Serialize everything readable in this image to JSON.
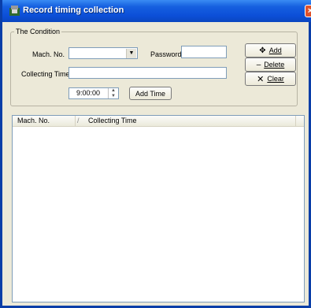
{
  "window": {
    "title": "Record timing collection",
    "close_glyph": "×"
  },
  "condition": {
    "legend": "The Condition",
    "mach_no_label": "Mach. No.",
    "mach_no_value": "",
    "password_label": "Password",
    "password_value": "",
    "collecting_time_label": "Collecting Time",
    "collecting_time_value": "",
    "time_value": "9:00:00",
    "add_time_label": "Add Time"
  },
  "actions": {
    "add_label": "Add",
    "delete_label": "Delete",
    "clear_label": "Clear"
  },
  "list": {
    "columns": [
      "Mach. No.",
      "Collecting Time"
    ],
    "rows": []
  }
}
